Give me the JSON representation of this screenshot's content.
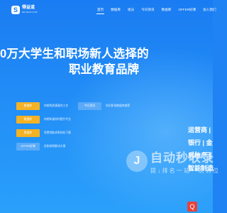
{
  "nav": {
    "logo_mark": "S",
    "logo_name": "得益道",
    "logo_sub": "DEYIDAO.COM",
    "items": [
      "首页",
      "数据库",
      "组员",
      "今日资讯",
      "数据库",
      "OFFER好课",
      "加入我们"
    ]
  },
  "hero": {
    "title": "0万大学生和职场新人选择的",
    "subtitle": "职业教育品牌"
  },
  "options": [
    {
      "button": "数据库",
      "label": "你想找到满意的工作",
      "style": "gold"
    },
    {
      "button": "今日资讯",
      "label": "知识职场数据库推荐",
      "style": "blue"
    },
    {
      "button": "数据库",
      "label": "你想知道如何提升专业",
      "style": "gold"
    },
    {
      "button": "数据库",
      "label": "免费领取求职材料下载",
      "style": "gold"
    },
    {
      "button": "OFFER好课",
      "label": "定制求职解决方案",
      "style": "blue"
    }
  ],
  "industries": [
    "运营商 |",
    "银行 | 金",
    "房地产 |",
    "智能制造"
  ],
  "watermark": {
    "mark": "J",
    "title": "自动秒收录",
    "sub": "提 ↓ 排 名 一 站 一 次 到 位"
  },
  "badge": "Q"
}
